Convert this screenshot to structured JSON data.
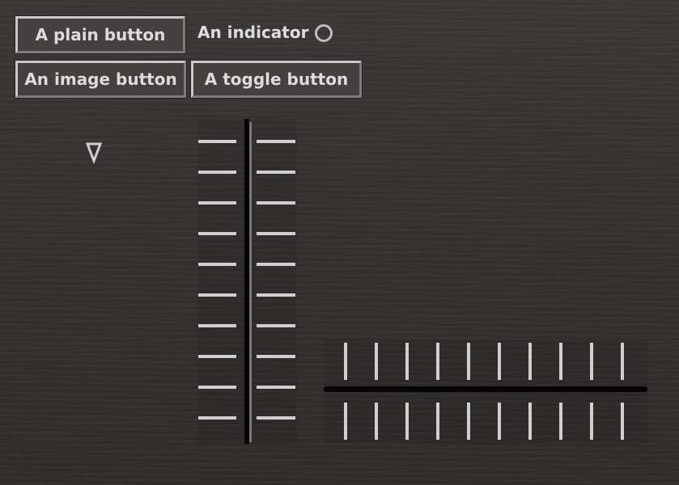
{
  "buttons": {
    "plain_label": "A plain button",
    "image_label": "An image button",
    "toggle_label": "A toggle button"
  },
  "indicator": {
    "label": "An indicator",
    "state": "off"
  },
  "dropdown": {
    "icon": "triangle-down-icon"
  },
  "vertical_slider": {
    "tick_count": 10
  },
  "horizontal_slider": {
    "tick_count": 10
  },
  "colors": {
    "background": "#363232",
    "button_face": "#454040",
    "text": "#dcdcdc",
    "tick": "#cfcfcf",
    "rail": "#050505"
  }
}
